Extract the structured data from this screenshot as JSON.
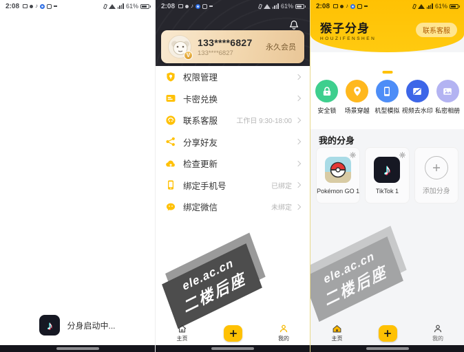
{
  "status_bar": {
    "time": "2:08",
    "battery": "61%"
  },
  "left_panel": {
    "loading_text": "分身启动中..."
  },
  "middle_panel": {
    "profile": {
      "name": "133****6827",
      "subname": "133****6827",
      "badge": "永久会员",
      "badge_mark": "V"
    },
    "menu": [
      {
        "label": "权限管理",
        "value": ""
      },
      {
        "label": "卡密兑换",
        "value": ""
      },
      {
        "label": "联系客服",
        "value": "工作日 9:30-18:00"
      },
      {
        "label": "分享好友",
        "value": ""
      },
      {
        "label": "检查更新",
        "value": ""
      },
      {
        "label": "绑定手机号",
        "value": "已绑定"
      },
      {
        "label": "绑定微信",
        "value": "未绑定"
      }
    ]
  },
  "right_panel": {
    "app_name": "猴子分身",
    "app_name_latin": "HOUZIFENSHEN",
    "contact_button": "联系客服",
    "features": [
      {
        "label": "安全锁",
        "color": "#3ECF8E",
        "icon": "lock-icon"
      },
      {
        "label": "场景穿越",
        "color": "#FFB81E",
        "icon": "location-pin-icon"
      },
      {
        "label": "机型模拟",
        "color": "#4D8DF7",
        "icon": "phone-icon"
      },
      {
        "label": "视频去水印",
        "color": "#3D66E8",
        "icon": "video-icon"
      },
      {
        "label": "私密相册",
        "color": "#B3B3F2",
        "icon": "photo-album-icon"
      }
    ],
    "section_title": "我的分身",
    "clones": [
      {
        "label": "Pokémon GO 1",
        "icon": "pokeball-icon"
      },
      {
        "label": "TikTok 1",
        "icon": "tiktok-icon"
      },
      {
        "label": "添加分身",
        "icon": "plus-icon"
      }
    ]
  },
  "bottom_nav": {
    "home_label": "主页",
    "mine_label": "我的"
  },
  "watermark": {
    "line1": "ele.ac.cn",
    "line2": "二楼后座"
  },
  "colors": {
    "primary_yellow": "#FFC103",
    "header_dark": "#26262D",
    "member_card_gold": "#F2D7AE",
    "member_text": "#7A5C32",
    "tiktok_dark": "#161823"
  }
}
